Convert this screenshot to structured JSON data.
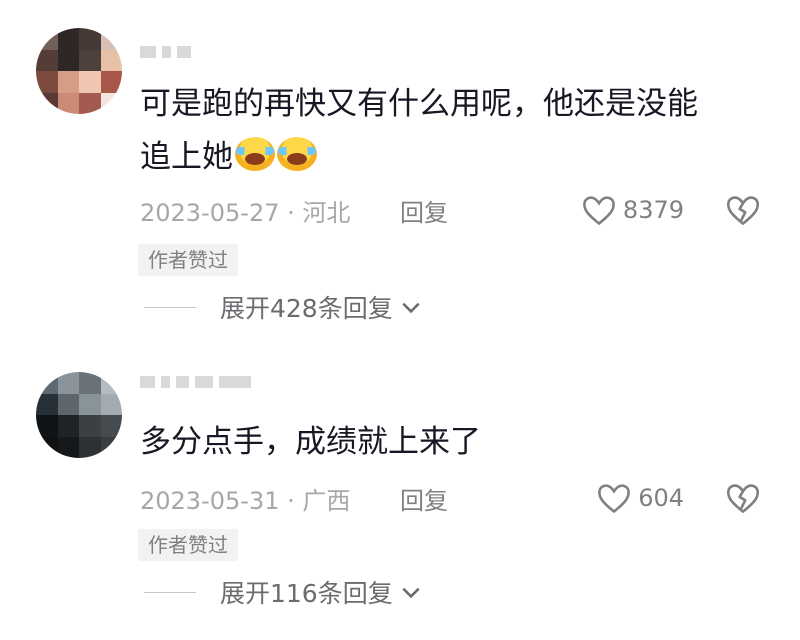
{
  "comments": [
    {
      "text_line1": "可是跑的再快又有什么用呢，他还是没能",
      "text_line2": "追上她",
      "emoji": [
        "crying-emoji",
        "crying-emoji"
      ],
      "time_location": "2023-05-27 · 河北",
      "reply": "回复",
      "likes": "8379",
      "badge": "作者赞过",
      "expand": "展开428条回复"
    },
    {
      "text": "多分点手，成绩就上来了",
      "time_location": "2023-05-31 · 广西",
      "reply": "回复",
      "likes": "604",
      "badge": "作者赞过",
      "expand": "展开116条回复"
    }
  ],
  "colors": {
    "text": "#161823",
    "secondary": "#a7a7ab",
    "action": "#808083",
    "badge_bg": "#f2f2f2"
  }
}
